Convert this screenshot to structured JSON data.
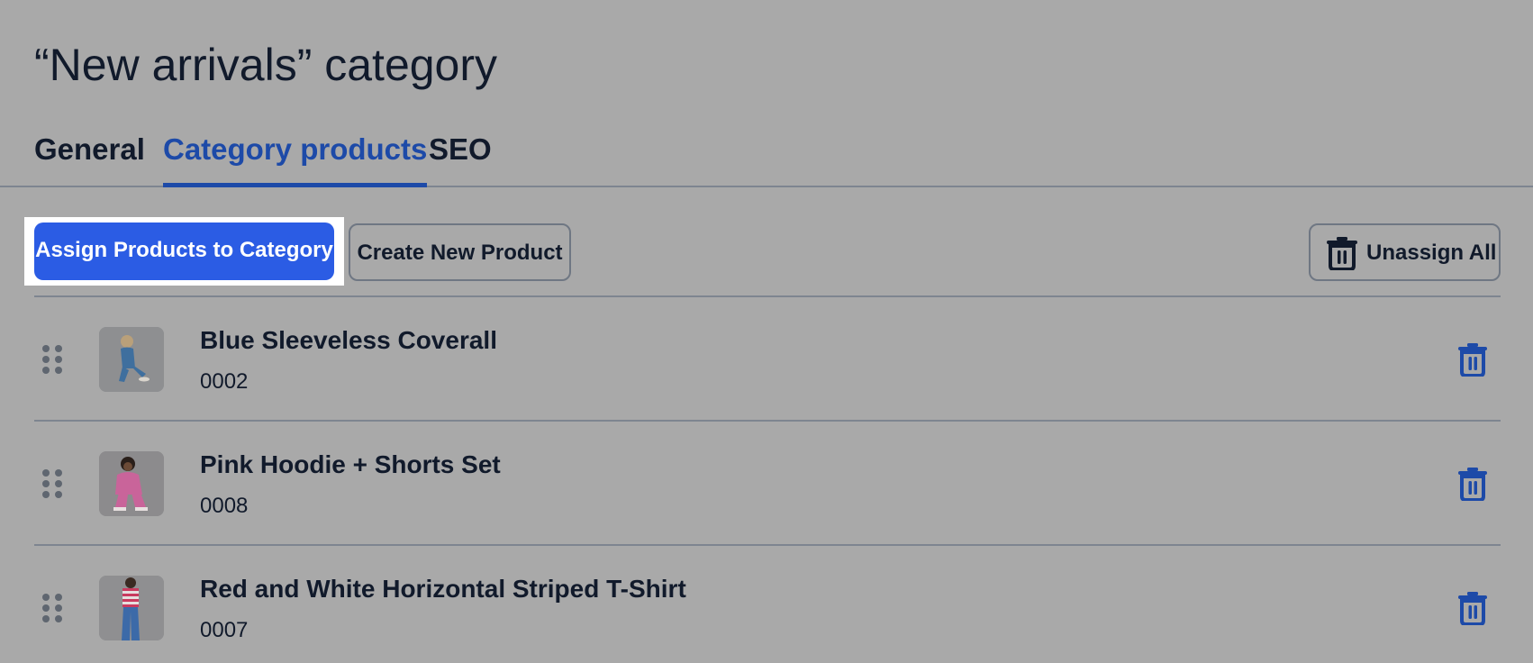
{
  "page": {
    "title": "“New arrivals” category"
  },
  "tabs": [
    {
      "label": "General",
      "active": false
    },
    {
      "label": "Category products",
      "active": true
    },
    {
      "label": "SEO",
      "active": false
    }
  ],
  "toolbar": {
    "assign_label": "Assign Products to Category",
    "create_label": "Create New Product",
    "unassign_all_label": "Unassign All",
    "unassign_icon": "trash-icon"
  },
  "products": [
    {
      "name": "Blue Sleeveless Coverall",
      "sku": "0002",
      "thumbnail": "child-blue-coverall-photo"
    },
    {
      "name": "Pink Hoodie + Shorts Set",
      "sku": "0008",
      "thumbnail": "child-pink-hoodie-photo"
    },
    {
      "name": "Red and White Horizontal Striped T-Shirt",
      "sku": "0007",
      "thumbnail": "child-striped-tshirt-photo"
    }
  ],
  "colors": {
    "background": "#a9a9a9",
    "accent": "#1d4aa8",
    "primary_button": "#2b5ce4",
    "highlight": "#ffffff",
    "text": "#111a2b"
  }
}
